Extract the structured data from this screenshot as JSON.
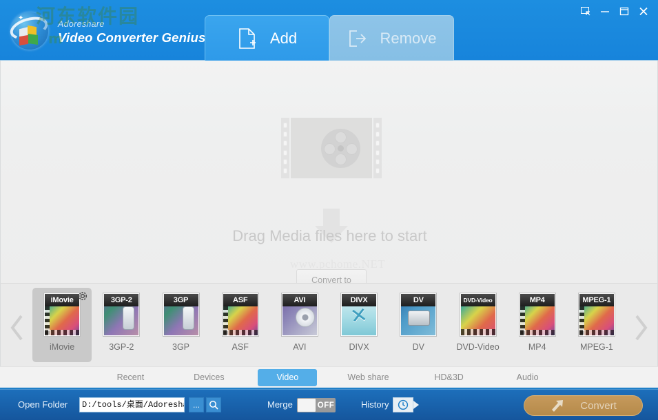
{
  "window": {
    "brand_sub": "Adoreshare",
    "brand_main": "Video Converter Genius",
    "watermark_cn": "河东软件园",
    "watermark_cn2": "m",
    "controls": [
      {
        "name": "feedback",
        "glyph": "feedback-icon"
      },
      {
        "name": "minimize",
        "glyph": "minimize-icon"
      },
      {
        "name": "maximize",
        "glyph": "maximize-icon"
      },
      {
        "name": "close",
        "glyph": "close-icon"
      }
    ]
  },
  "toptabs": [
    {
      "label": "Add",
      "icon": "file-add-icon",
      "state": "active"
    },
    {
      "label": "Remove",
      "icon": "arrow-out-icon",
      "state": "disabled"
    }
  ],
  "main": {
    "drag_text": "Drag Media files here to start",
    "watermark": "www.pchome.NET",
    "convert_to_label": "Convert to",
    "placeholder_icon": "film-reel-icon",
    "arrow_icon": "arrow-down-icon"
  },
  "formats": {
    "prev_icon": "chevron-left-icon",
    "next_icon": "chevron-right-icon",
    "gear_icon": "gear-icon",
    "items": [
      {
        "cap": "iMovie",
        "label": "iMovie",
        "art": "film-mosaic",
        "selected": true,
        "capsmall": false
      },
      {
        "cap": "3GP-2",
        "label": "3GP-2",
        "art": "purple-phone",
        "selected": false,
        "capsmall": false
      },
      {
        "cap": "3GP",
        "label": "3GP",
        "art": "purple-phone",
        "selected": false,
        "capsmall": false
      },
      {
        "cap": "ASF",
        "label": "ASF",
        "art": "film-mosaic",
        "selected": false,
        "capsmall": false
      },
      {
        "cap": "AVI",
        "label": "AVI",
        "art": "disc",
        "selected": false,
        "capsmall": false
      },
      {
        "cap": "DIVX",
        "label": "DIVX",
        "art": "divx",
        "selected": false,
        "capsmall": false
      },
      {
        "cap": "DV",
        "label": "DV",
        "art": "camcorder",
        "selected": false,
        "capsmall": false
      },
      {
        "cap": "DVD-Video",
        "label": "DVD-Video",
        "art": "dvd",
        "selected": false,
        "capsmall": true
      },
      {
        "cap": "MP4",
        "label": "MP4",
        "art": "film-mosaic",
        "selected": false,
        "capsmall": false
      },
      {
        "cap": "MPEG-1",
        "label": "MPEG-1",
        "art": "film-mosaic",
        "selected": false,
        "capsmall": false
      }
    ]
  },
  "categories": [
    {
      "label": "Recent",
      "active": false
    },
    {
      "label": "Devices",
      "active": false
    },
    {
      "label": "Video",
      "active": true
    },
    {
      "label": "Web share",
      "active": false
    },
    {
      "label": "HD&3D",
      "active": false
    },
    {
      "label": "Audio",
      "active": false
    }
  ],
  "bottom": {
    "open_folder_label": "Open Folder",
    "path_value": "D:/tools/桌面/Adoreshare",
    "browse_label": "...",
    "search_icon": "search-icon",
    "merge_label": "Merge",
    "merge_state": "OFF",
    "history_label": "History",
    "history_icon": "clock-icon",
    "convert_label": "Convert",
    "convert_icon": "convert-arrow-icon"
  },
  "colors": {
    "title_blue": "#1b8ade",
    "tab_active_blue": "#2e9ae9",
    "bottom_blue": "#15569d",
    "cat_active": "#54aee8",
    "convert_gold": "#b58a4a"
  }
}
